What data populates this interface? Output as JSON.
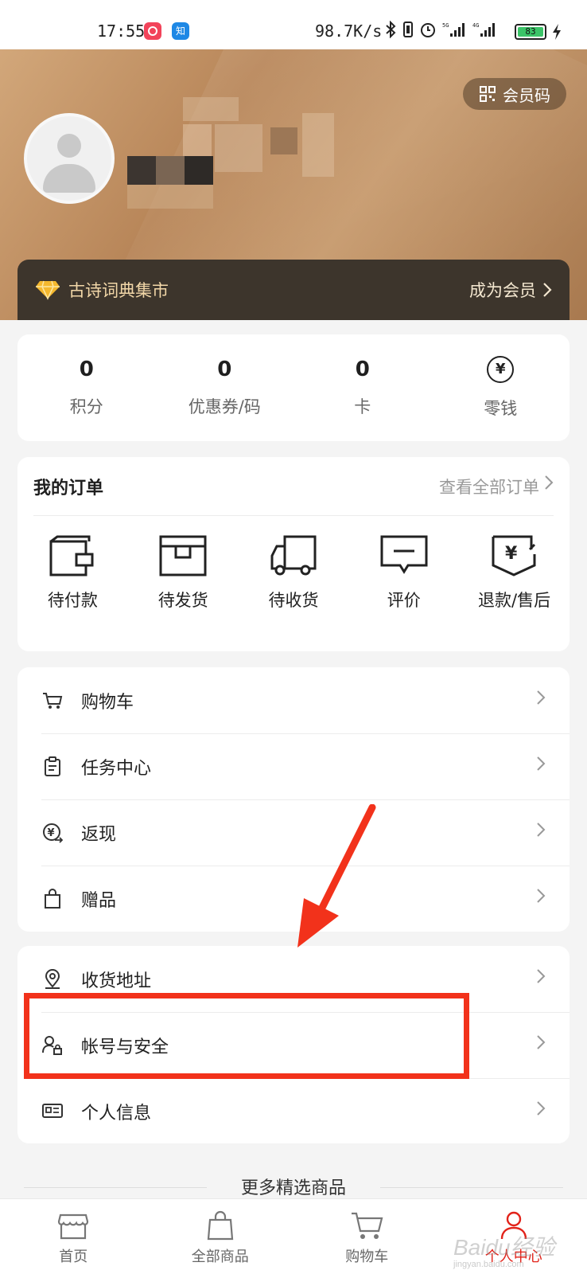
{
  "status_bar": {
    "time": "17:55",
    "app2_icon_text": "知",
    "network_speed": "98.7K/s",
    "battery": "83"
  },
  "header": {
    "member_code_label": "会员码"
  },
  "vip": {
    "store_name": "古诗词典集市",
    "join_label": "成为会员"
  },
  "stats": [
    {
      "value": "0",
      "label": "积分"
    },
    {
      "value": "0",
      "label": "优惠券/码"
    },
    {
      "value": "0",
      "label": "卡"
    },
    {
      "icon_text": "¥",
      "label": "零钱"
    }
  ],
  "orders": {
    "title": "我的订单",
    "view_all": "查看全部订单",
    "items": [
      {
        "label": "待付款",
        "icon": "wallet-icon"
      },
      {
        "label": "待发货",
        "icon": "box-icon"
      },
      {
        "label": "待收货",
        "icon": "truck-icon"
      },
      {
        "label": "评价",
        "icon": "comment-icon"
      },
      {
        "label": "退款/售后",
        "icon": "refund-icon"
      }
    ]
  },
  "menu1": [
    {
      "label": "购物车",
      "icon": "cart-icon"
    },
    {
      "label": "任务中心",
      "icon": "clipboard-icon"
    },
    {
      "label": "返现",
      "icon": "cashback-icon"
    },
    {
      "label": "赠品",
      "icon": "gift-bag-icon"
    }
  ],
  "menu2": [
    {
      "label": "收货地址",
      "icon": "location-icon"
    },
    {
      "label": "帐号与安全",
      "icon": "account-lock-icon"
    },
    {
      "label": "个人信息",
      "icon": "id-card-icon"
    }
  ],
  "more_title": "更多精选商品",
  "bottom_nav": [
    {
      "label": "首页",
      "icon": "store-icon"
    },
    {
      "label": "全部商品",
      "icon": "bag-icon"
    },
    {
      "label": "购物车",
      "icon": "cart-icon"
    },
    {
      "label": "个人中心",
      "icon": "person-icon",
      "active": true
    }
  ],
  "watermark": {
    "text": "Baidu经验",
    "sub": "jingyan.baidu.com"
  },
  "colors": {
    "accent": "#e2231a",
    "vip_bar": "#3d352c",
    "vip_text": "#f2d7a8",
    "annotation": "#f2321b"
  }
}
